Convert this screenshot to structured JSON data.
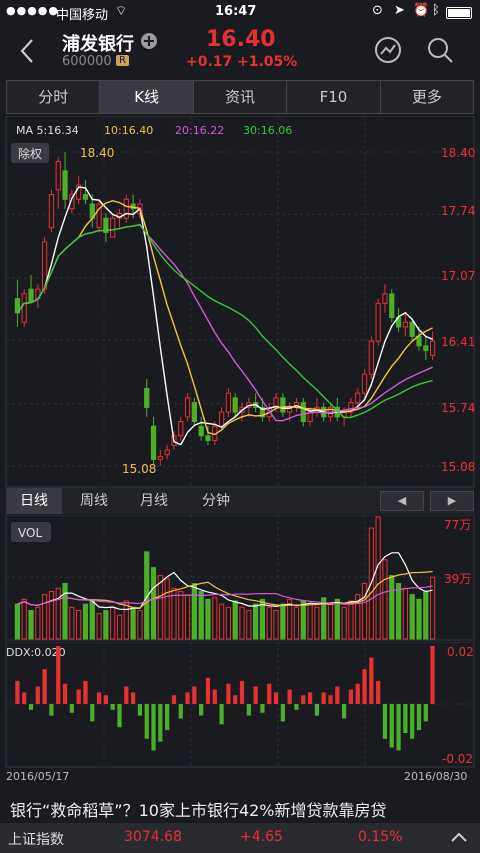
{
  "status_bar": {
    "signal": "●●●●●",
    "carrier": "中国移动",
    "time": "16:47",
    "battery": "battery-icon"
  },
  "header": {
    "back_icon": "chevron-left-icon",
    "name": "浦发银行",
    "add_icon": "plus-circle-icon",
    "code": "600000",
    "badge": "R",
    "price": "16.40",
    "change": "+0.17",
    "change_pct": "+1.05%",
    "share_icon": "chart-share-icon",
    "search_icon": "search-icon"
  },
  "tabs": [
    {
      "label": "分时"
    },
    {
      "label": "K线"
    },
    {
      "label": "资讯"
    },
    {
      "label": "F10"
    },
    {
      "label": "更多"
    }
  ],
  "ma": {
    "ma5": "MA 5:16.34",
    "ma10": "10:16.40",
    "ma20": "20:16.22",
    "ma30": "30:16.06"
  },
  "fq_button": "除权",
  "price_axis": [
    "18.40",
    "17.74",
    "17.07",
    "16.41",
    "15.74",
    "15.08"
  ],
  "high_label": "18.40",
  "low_label": "15.08",
  "period_tabs": [
    "日线",
    "周线",
    "月线",
    "分钟"
  ],
  "vol": {
    "label": "VOL",
    "axis_top": "77万",
    "axis_mid": "39万"
  },
  "ddx": {
    "label": "DDX:0.020",
    "axis_top": "0.02",
    "axis_bottom": "-0.02"
  },
  "dates": {
    "start": "2016/05/17",
    "end": "2016/08/30"
  },
  "news": "银行“救命稻草”？10家上市银行42%新增贷款靠房贷",
  "ticker": {
    "name": "上证指数",
    "value": "3074.68",
    "change": "+4.65",
    "pct": "0.15%"
  },
  "colors": {
    "up": "#e6312f",
    "down": "#4caf29",
    "ma5": "#ffffff",
    "ma10": "#f5c342",
    "ma20": "#d45ad8",
    "ma30": "#35c935"
  },
  "chart_data": {
    "type": "candlestick",
    "ylim": [
      15.08,
      18.4
    ],
    "ohlc": [
      [
        16.85,
        17.05,
        16.55,
        16.7
      ],
      [
        16.6,
        16.95,
        16.55,
        16.9
      ],
      [
        16.95,
        17.1,
        16.8,
        16.82
      ],
      [
        16.85,
        17.0,
        16.75,
        16.95
      ],
      [
        16.95,
        17.5,
        16.9,
        17.45
      ],
      [
        17.6,
        18.0,
        17.55,
        17.95
      ],
      [
        18.0,
        18.35,
        17.8,
        18.3
      ],
      [
        18.2,
        18.4,
        17.8,
        17.9
      ],
      [
        17.8,
        18.0,
        17.75,
        17.95
      ],
      [
        17.9,
        18.15,
        17.85,
        18.05
      ],
      [
        17.95,
        18.1,
        17.85,
        17.9
      ],
      [
        17.85,
        17.95,
        17.6,
        17.7
      ],
      [
        17.6,
        17.9,
        17.55,
        17.85
      ],
      [
        17.7,
        17.75,
        17.45,
        17.55
      ],
      [
        17.5,
        17.75,
        17.5,
        17.7
      ],
      [
        17.7,
        17.8,
        17.6,
        17.75
      ],
      [
        17.7,
        17.95,
        17.65,
        17.9
      ],
      [
        17.85,
        17.95,
        17.7,
        17.8
      ],
      [
        17.75,
        17.9,
        17.7,
        17.85
      ],
      [
        15.9,
        16.0,
        15.6,
        15.7
      ],
      [
        15.5,
        15.6,
        15.1,
        15.15
      ],
      [
        15.15,
        15.25,
        15.08,
        15.18
      ],
      [
        15.2,
        15.3,
        15.15,
        15.25
      ],
      [
        15.3,
        15.45,
        15.25,
        15.4
      ],
      [
        15.4,
        15.6,
        15.35,
        15.55
      ],
      [
        15.6,
        15.85,
        15.55,
        15.8
      ],
      [
        15.75,
        15.8,
        15.5,
        15.55
      ],
      [
        15.5,
        15.6,
        15.35,
        15.4
      ],
      [
        15.4,
        15.5,
        15.3,
        15.35
      ],
      [
        15.35,
        15.55,
        15.3,
        15.5
      ],
      [
        15.5,
        15.7,
        15.45,
        15.65
      ],
      [
        15.65,
        15.9,
        15.6,
        15.85
      ],
      [
        15.8,
        15.85,
        15.6,
        15.65
      ],
      [
        15.65,
        15.75,
        15.55,
        15.7
      ],
      [
        15.7,
        15.8,
        15.6,
        15.75
      ],
      [
        15.75,
        15.85,
        15.65,
        15.7
      ],
      [
        15.7,
        15.8,
        15.55,
        15.6
      ],
      [
        15.6,
        15.75,
        15.55,
        15.7
      ],
      [
        15.7,
        15.85,
        15.65,
        15.8
      ],
      [
        15.8,
        15.85,
        15.6,
        15.65
      ],
      [
        15.65,
        15.75,
        15.55,
        15.7
      ],
      [
        15.7,
        15.8,
        15.65,
        15.75
      ],
      [
        15.75,
        15.8,
        15.5,
        15.55
      ],
      [
        15.55,
        15.7,
        15.5,
        15.65
      ],
      [
        15.65,
        15.8,
        15.6,
        15.7
      ],
      [
        15.7,
        15.75,
        15.55,
        15.6
      ],
      [
        15.6,
        15.75,
        15.55,
        15.7
      ],
      [
        15.7,
        15.8,
        15.55,
        15.6
      ],
      [
        15.6,
        15.7,
        15.5,
        15.65
      ],
      [
        15.65,
        15.8,
        15.6,
        15.75
      ],
      [
        15.75,
        15.9,
        15.7,
        15.85
      ],
      [
        15.85,
        16.1,
        15.8,
        16.05
      ],
      [
        16.05,
        16.45,
        16.0,
        16.4
      ],
      [
        16.4,
        16.85,
        16.35,
        16.8
      ],
      [
        16.8,
        17.0,
        16.7,
        16.9
      ],
      [
        16.9,
        16.95,
        16.6,
        16.65
      ],
      [
        16.65,
        16.75,
        16.5,
        16.55
      ],
      [
        16.55,
        16.7,
        16.45,
        16.6
      ],
      [
        16.6,
        16.65,
        16.4,
        16.45
      ],
      [
        16.45,
        16.55,
        16.3,
        16.35
      ],
      [
        16.35,
        16.45,
        16.2,
        16.3
      ],
      [
        16.25,
        16.5,
        16.2,
        16.4
      ]
    ],
    "volume": [
      22,
      25,
      18,
      20,
      28,
      30,
      32,
      35,
      20,
      18,
      22,
      25,
      16,
      18,
      20,
      15,
      24,
      20,
      18,
      55,
      45,
      40,
      38,
      32,
      30,
      28,
      35,
      30,
      25,
      26,
      22,
      20,
      24,
      20,
      18,
      22,
      25,
      20,
      18,
      22,
      25,
      20,
      24,
      22,
      20,
      26,
      22,
      25,
      20,
      24,
      28,
      35,
      70,
      77,
      50,
      40,
      35,
      32,
      28,
      25,
      30,
      39
    ],
    "ddx": [
      0.008,
      0.004,
      -0.002,
      0.006,
      0.012,
      -0.004,
      0.02,
      0.007,
      -0.003,
      0.005,
      0.008,
      -0.006,
      0.004,
      0.003,
      -0.002,
      -0.008,
      0.006,
      0.004,
      -0.004,
      -0.012,
      -0.016,
      -0.013,
      -0.009,
      0.003,
      -0.005,
      0.004,
      0.006,
      -0.004,
      0.009,
      0.005,
      -0.007,
      0.007,
      0.003,
      0.008,
      -0.004,
      0.006,
      -0.003,
      0.007,
      0.004,
      -0.006,
      0.005,
      -0.002,
      0.003,
      0.004,
      -0.004,
      0.004,
      0.003,
      0.006,
      -0.005,
      0.005,
      0.007,
      0.012,
      0.016,
      0.008,
      -0.012,
      -0.015,
      -0.016,
      -0.01,
      -0.012,
      -0.009,
      -0.006,
      0.02
    ]
  }
}
